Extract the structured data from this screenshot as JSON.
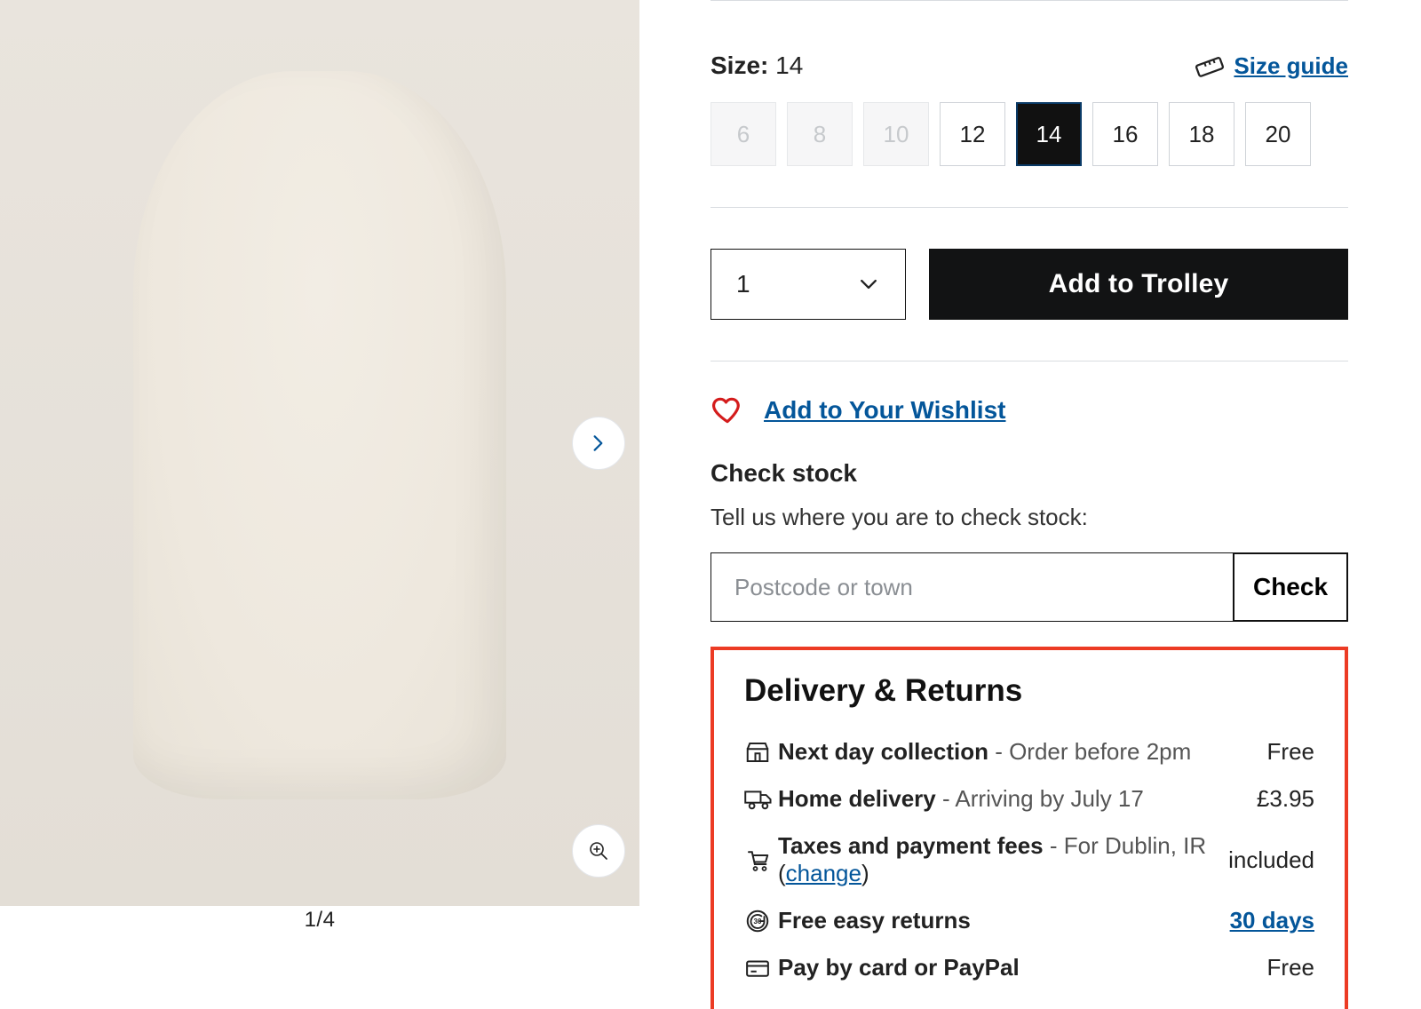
{
  "gallery": {
    "counter": "1/4"
  },
  "size": {
    "label_prefix": "Size:",
    "selected": "14",
    "guide_link": "Size guide",
    "options": [
      {
        "value": "6",
        "disabled": true,
        "selected": false
      },
      {
        "value": "8",
        "disabled": true,
        "selected": false
      },
      {
        "value": "10",
        "disabled": true,
        "selected": false
      },
      {
        "value": "12",
        "disabled": false,
        "selected": false
      },
      {
        "value": "14",
        "disabled": false,
        "selected": true
      },
      {
        "value": "16",
        "disabled": false,
        "selected": false
      },
      {
        "value": "18",
        "disabled": false,
        "selected": false
      },
      {
        "value": "20",
        "disabled": false,
        "selected": false
      }
    ]
  },
  "buy": {
    "qty": "1",
    "add_trolley": "Add to Trolley"
  },
  "wishlist": {
    "label": "Add to Your Wishlist"
  },
  "stock": {
    "title": "Check stock",
    "sub": "Tell us where you are to check stock:",
    "placeholder": "Postcode or town",
    "check_btn": "Check"
  },
  "delivery": {
    "heading": "Delivery & Returns",
    "rows": [
      {
        "icon": "store",
        "title": "Next day collection",
        "note": "Order before 2pm",
        "right": "Free",
        "change": "",
        "right_link": ""
      },
      {
        "icon": "truck",
        "title": "Home delivery",
        "note": "Arriving by July 17",
        "right": "£3.95",
        "change": "",
        "right_link": ""
      },
      {
        "icon": "cart",
        "title": "Taxes and payment fees",
        "note": "For Dublin, IR",
        "right": "included",
        "change": "change",
        "right_link": ""
      },
      {
        "icon": "return",
        "title": "Free easy returns",
        "note": "",
        "right": "",
        "change": "",
        "right_link": "30 days"
      },
      {
        "icon": "card",
        "title": "Pay by card or PayPal",
        "note": "",
        "right": "Free",
        "change": "",
        "right_link": ""
      }
    ]
  }
}
